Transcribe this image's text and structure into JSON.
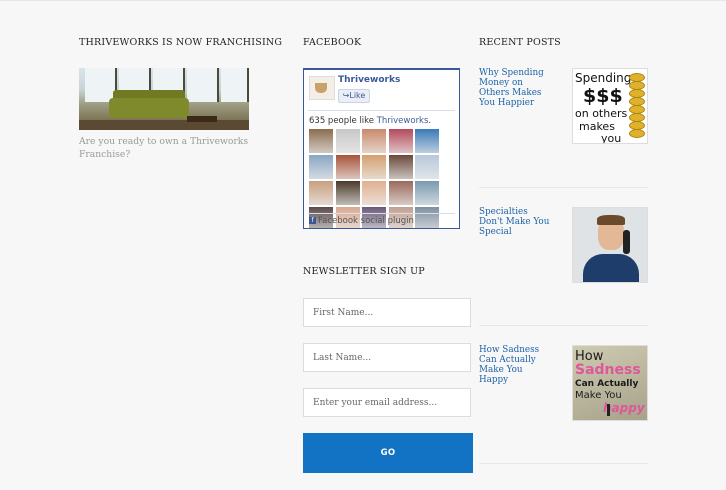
{
  "columns": {
    "franchise": {
      "heading": "THRIVEWORKS IS NOW FRANCHISING",
      "caption": "Are you ready to own a Thriveworks Franchise?"
    },
    "facebook": {
      "heading": "FACEBOOK",
      "page_name": "Thriveworks",
      "like_button": "Like",
      "count_prefix": "635 people like ",
      "count_page": "Thriveworks",
      "count_suffix": ".",
      "plugin_label": "Facebook social plugin"
    },
    "newsletter": {
      "heading": "NEWSLETTER SIGN UP",
      "first_name_placeholder": "First Name...",
      "last_name_placeholder": "Last Name...",
      "email_placeholder": "Enter your email address...",
      "submit_label": "GO"
    },
    "recent_posts": {
      "heading": "RECENT POSTS",
      "posts": [
        {
          "title": "Why Spending Money on Others Makes You Happier"
        },
        {
          "title": "Specialties Don't Make You Special"
        },
        {
          "title": "How Sadness Can Actually Make You Happy"
        }
      ]
    }
  },
  "thumb1_text": {
    "a": "Spending",
    "b": "$$$",
    "c": "on others",
    "d": "makes",
    "e": "you"
  },
  "thumb3_text": {
    "a": "How",
    "b": "Sadness",
    "c": "Can Actually",
    "d": "Make You",
    "e": "happy"
  },
  "colors": {
    "background": "#f7f7f7",
    "link": "#1e63a8",
    "button": "#1273c4",
    "facebook_blue": "#3b5998"
  },
  "facebook_faces": [
    "#8a6d4e",
    "#c7c7c7",
    "#c98a6a",
    "#b44a5a",
    "#3a7ab8",
    "#8aa6c2",
    "#a8543a",
    "#d4a070",
    "#6a4a3a",
    "#b8c8d8",
    "#c8a080",
    "#4a3a2a",
    "#e0b090",
    "#9a6a5a",
    "#7a9ab0",
    "#5a4a4a",
    "#d8a890",
    "#6a5a7a",
    "#c0a090",
    "#8090a0"
  ]
}
